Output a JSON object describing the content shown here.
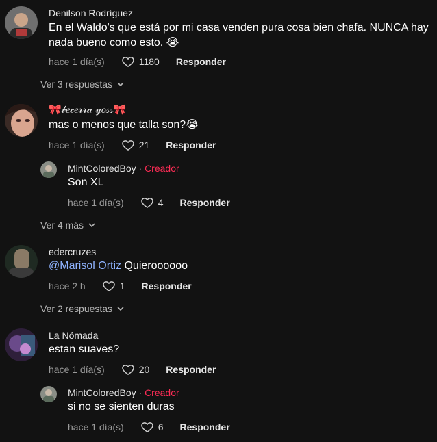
{
  "comments": [
    {
      "username": "Denilson Rodríguez",
      "text": "En el Waldo's que está por mi casa venden pura cosa bien chafa. NUNCA hay nada bueno como esto. 😭",
      "time": "hace 1 día(s)",
      "likes": "1180",
      "reply_label": "Responder"
    },
    {
      "username": "🎀𝒷𝑒𝒸𝑒𝓇𝓇𝒶 𝓎𝑜𝓈𝓈🎀",
      "text": "mas o menos que talla son?😭",
      "time": "hace 1 día(s)",
      "likes": "21",
      "reply_label": "Responder"
    },
    {
      "username": "edercruzes",
      "mention": "@Marisol Ortiz",
      "text": " Quieroooooo",
      "time": "hace 2 h",
      "likes": "1",
      "reply_label": "Responder"
    },
    {
      "username": "La Nómada",
      "text": "estan suaves?",
      "time": "hace 1 día(s)",
      "likes": "20",
      "reply_label": "Responder"
    }
  ],
  "replies": [
    {
      "username": "MintColoredBoy",
      "separator": " · ",
      "badge": "Creador",
      "text": "Son XL",
      "time": "hace 1 día(s)",
      "likes": "4",
      "reply_label": "Responder"
    },
    {
      "username": "MintColoredBoy",
      "separator": " · ",
      "badge": "Creador",
      "text": "si no se sienten duras",
      "time": "hace 1 día(s)",
      "likes": "6",
      "reply_label": "Responder"
    }
  ],
  "view_more": [
    "Ver 3 respuestas",
    "Ver 4 más",
    "Ver 2 respuestas"
  ],
  "colors": {
    "background": "#121212",
    "creator_badge": "#fe2c55",
    "mention": "#8fb3ff"
  }
}
